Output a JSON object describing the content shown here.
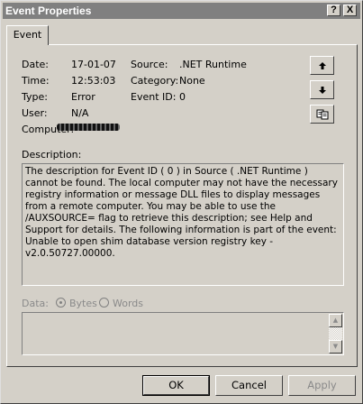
{
  "window": {
    "title": "Event Properties",
    "help_glyph": "?",
    "close_glyph": "X"
  },
  "tabs": [
    {
      "label": "Event"
    }
  ],
  "event": {
    "date_label": "Date:",
    "date": "17-01-07",
    "time_label": "Time:",
    "time": "12:53:03",
    "type_label": "Type:",
    "type": "Error",
    "user_label": "User:",
    "user": "N/A",
    "computer_label": "Computer:",
    "source_label": "Source:",
    "source": ".NET Runtime",
    "category_label": "Category:",
    "category": "None",
    "event_id_label": "Event ID:",
    "event_id": "0"
  },
  "description": {
    "label": "Description:",
    "text": "The description for Event ID ( 0 ) in Source ( .NET Runtime ) cannot be found. The local computer may not have the necessary registry information or message DLL files to display messages from a remote computer. You may be able to use the /AUXSOURCE= flag to retrieve this description; see Help and Support for details. The following information is part of the event: Unable to open shim database version registry key - v2.0.50727.00000."
  },
  "data": {
    "label": "Data:",
    "bytes_label": "Bytes",
    "words_label": "Words"
  },
  "buttons": {
    "ok": "OK",
    "cancel": "Cancel",
    "apply": "Apply"
  },
  "icons": {
    "up": "arrow-up-icon",
    "down": "arrow-down-icon",
    "copy": "copy-icon"
  }
}
